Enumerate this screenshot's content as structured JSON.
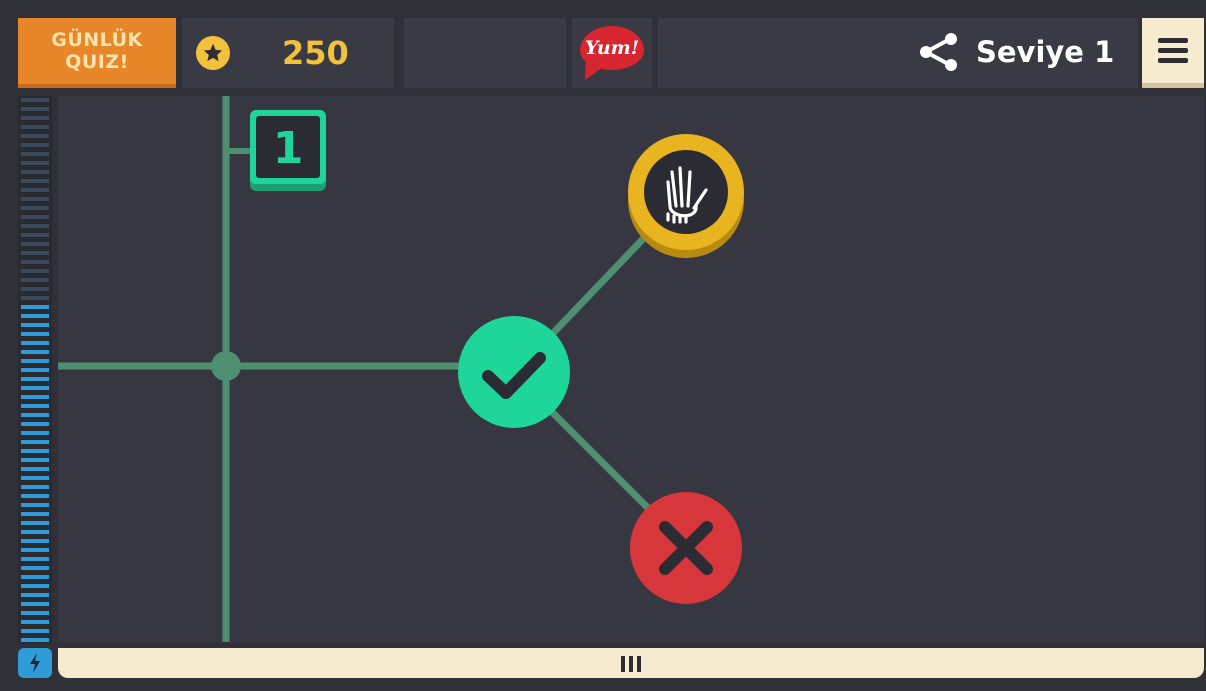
{
  "header": {
    "daily_quiz_label": "GÜNLÜK\nQUIZ!",
    "coins": "250",
    "ad_brand": "Yum!",
    "level_label": "Seviye 1"
  },
  "board": {
    "level_marker": "1",
    "nodes": [
      {
        "kind": "hand",
        "icon": "hand-icon",
        "color": "#e8b41f"
      },
      {
        "kind": "check",
        "icon": "checkmark-icon",
        "color": "#1ed69a"
      },
      {
        "kind": "cross",
        "icon": "x-icon",
        "color": "#d7363b"
      }
    ]
  },
  "energy": {
    "level": 0.62
  },
  "colors": {
    "accent_orange": "#e8862a",
    "coin_gold": "#f2c23c",
    "path_green": "#4d8f70",
    "meter_blue": "#2f9bd8",
    "cream": "#f6ebcf"
  }
}
